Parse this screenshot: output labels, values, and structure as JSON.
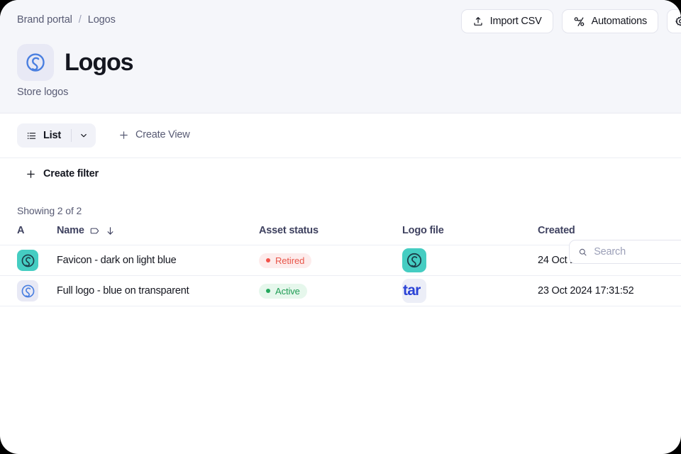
{
  "breadcrumb": {
    "root": "Brand portal",
    "separator": "/",
    "current": "Logos"
  },
  "header": {
    "title": "Logos",
    "subtitle": "Store logos",
    "icon": "spiral-logo-icon",
    "icon_bg": "#e8e9f5",
    "icon_color": "#4a7fe0",
    "background": "#f5f6fa"
  },
  "actions": {
    "import_csv": "Import CSV",
    "import_csv_icon": "upload-icon",
    "automations": "Automations",
    "automations_icon": "automation-nodes-icon",
    "settings_icon": "gear-icon"
  },
  "viewbar": {
    "view_label": "List",
    "view_icon": "list-icon",
    "chevron_icon": "chevron-down-icon",
    "create_view": "Create View",
    "create_view_icon": "plus-icon",
    "pill_bg": "#f1f2f8"
  },
  "search": {
    "placeholder": "Search",
    "value": "",
    "icon": "search-icon"
  },
  "filters": {
    "create_filter": "Create filter",
    "create_filter_icon": "plus-icon"
  },
  "table": {
    "showing": "Showing 2 of 2",
    "columns": {
      "avatar": "A",
      "name": "Name",
      "name_type_icon": "tag-icon",
      "name_sort_icon": "arrow-down-icon",
      "asset_status": "Asset status",
      "logo_file": "Logo file",
      "created": "Created"
    },
    "rows": [
      {
        "avatar_icon": "spiral-logo-icon",
        "avatar_bg": "#45cdc2",
        "avatar_color": "#1c3f4a",
        "name": "Favicon - dark on light blue",
        "status": "Retired",
        "status_color": "#e8564a",
        "status_bg": "#fdecec",
        "status_dot": "#f2524a",
        "logo_thumb_kind": "icon",
        "logo_thumb_icon": "spiral-logo-icon",
        "logo_thumb_bg": "#45cdc2",
        "logo_thumb_color": "#1c3f4a",
        "created": "24 Oct 2024 15:47:39"
      },
      {
        "avatar_icon": "spiral-logo-icon",
        "avatar_bg": "#e8e9f5",
        "avatar_color": "#4a7fe0",
        "name": "Full logo - blue on transparent",
        "status": "Active",
        "status_color": "#1f9c54",
        "status_bg": "#e6f7ec",
        "status_dot": "#23a85c",
        "logo_thumb_kind": "wordmark",
        "logo_thumb_text": "tar",
        "logo_thumb_bg": "#eceef7",
        "logo_thumb_color": "#2b43d6",
        "created": "23 Oct 2024 17:31:52"
      }
    ]
  }
}
